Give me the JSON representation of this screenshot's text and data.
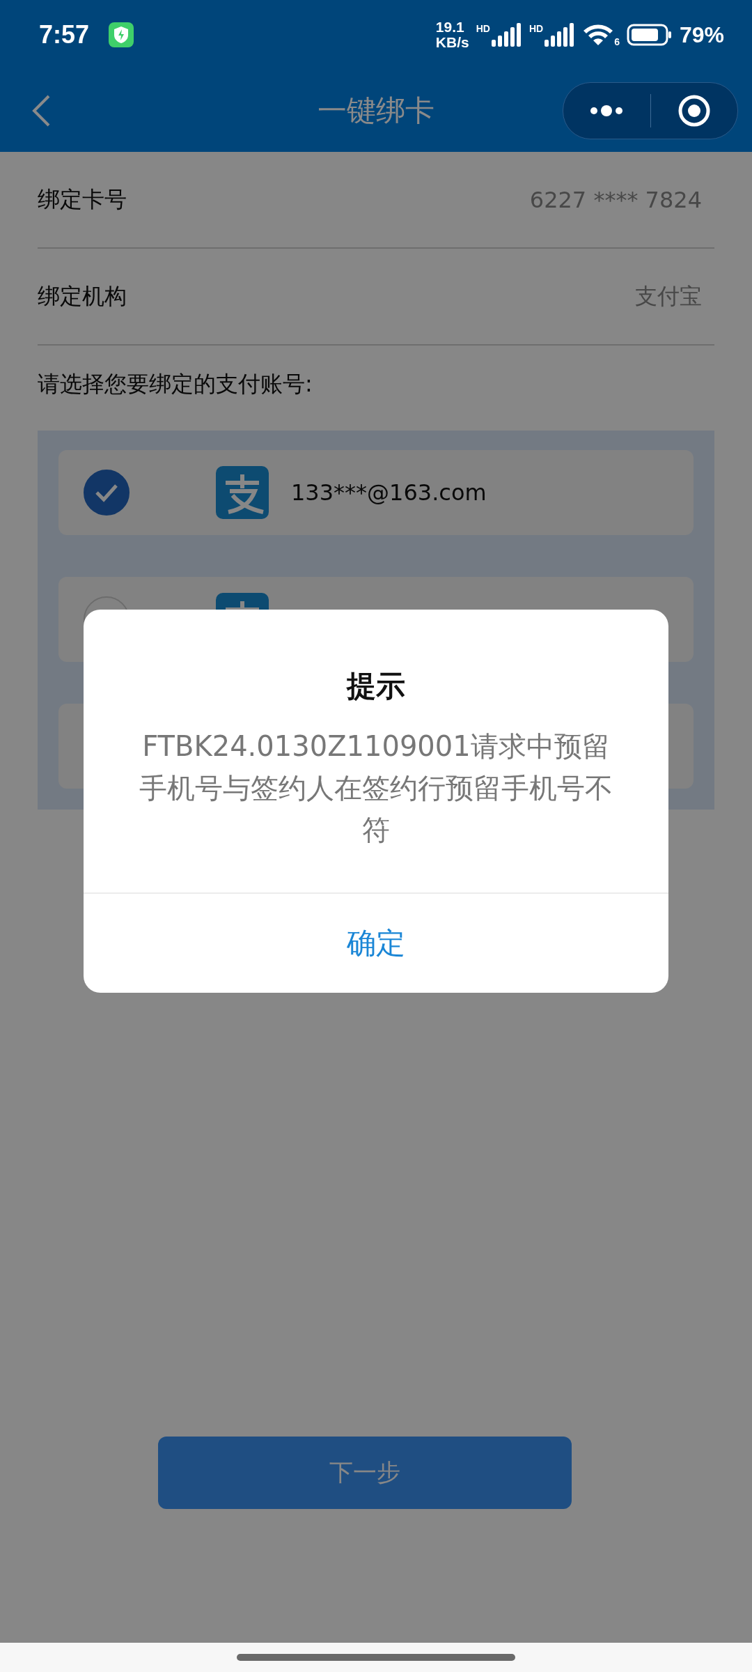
{
  "status_bar": {
    "time": "7:57",
    "speed_value": "19.1",
    "speed_unit": "KB/s",
    "sim_labels": [
      "HD",
      "HD"
    ],
    "wifi_label": "6",
    "battery": "79%"
  },
  "header": {
    "title": "一键绑卡"
  },
  "fields": [
    {
      "label": "绑定卡号",
      "value": "6227 **** 7824"
    },
    {
      "label": "绑定机构",
      "value": "支付宝"
    }
  ],
  "prompt": "请选择您要绑定的支付账号:",
  "accounts": [
    {
      "selected": true,
      "account": "133***@163.com"
    },
    {
      "selected": false
    }
  ],
  "dialog": {
    "title": "提示",
    "message": "FTBK24.0130Z1109001请求中预留手机号与签约人在签约行预留手机号不符",
    "button": "确定"
  },
  "next_button": "下一步"
}
